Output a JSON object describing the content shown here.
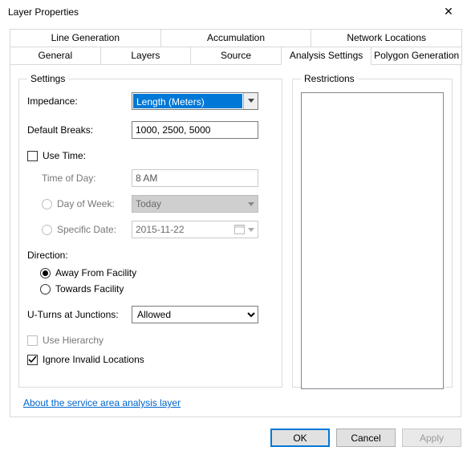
{
  "window": {
    "title": "Layer Properties"
  },
  "tabs": {
    "row1": [
      "Line Generation",
      "Accumulation",
      "Network Locations"
    ],
    "row2": [
      "General",
      "Layers",
      "Source",
      "Analysis Settings",
      "Polygon Generation"
    ],
    "active": "Analysis Settings"
  },
  "settings": {
    "legend": "Settings",
    "impedance_label": "Impedance:",
    "impedance_value": "Length (Meters)",
    "default_breaks_label": "Default Breaks:",
    "default_breaks_value": "1000, 2500, 5000",
    "use_time_label": "Use Time:",
    "use_time_checked": false,
    "time_of_day_label": "Time of Day:",
    "time_of_day_value": "8 AM",
    "day_of_week_label": "Day of Week:",
    "day_of_week_value": "Today",
    "specific_date_label": "Specific Date:",
    "specific_date_value": "2015-11-22",
    "direction_label": "Direction:",
    "direction_options": {
      "away": "Away From Facility",
      "towards": "Towards Facility"
    },
    "direction_selected": "away",
    "uturns_label": "U-Turns at Junctions:",
    "uturns_value": "Allowed",
    "use_hierarchy_label": "Use Hierarchy",
    "use_hierarchy_checked": false,
    "use_hierarchy_enabled": false,
    "ignore_invalid_label": "Ignore Invalid Locations",
    "ignore_invalid_checked": true
  },
  "restrictions": {
    "legend": "Restrictions"
  },
  "link": {
    "label": "About the service area analysis layer"
  },
  "buttons": {
    "ok": "OK",
    "cancel": "Cancel",
    "apply": "Apply"
  }
}
